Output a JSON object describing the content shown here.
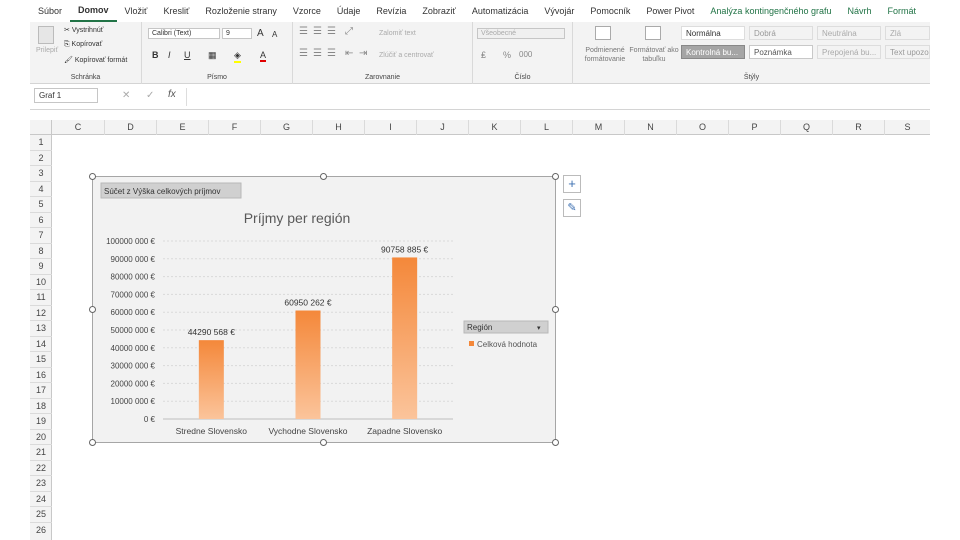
{
  "tabs": [
    "Súbor",
    "Domov",
    "Vložiť",
    "Kresliť",
    "Rozloženie strany",
    "Vzorce",
    "Údaje",
    "Revízia",
    "Zobraziť",
    "Automatizácia",
    "Vývojár",
    "Pomocník",
    "Power Pivot",
    "Analýza kontingenčného grafu",
    "Návrh",
    "Formát"
  ],
  "ribbon": {
    "clipboard": {
      "paste": "Prilepiť",
      "cut": "Vystrihnúť",
      "copy": "Kopírovať",
      "format": "Kopírovať formát",
      "label": "Schránka"
    },
    "font": {
      "name": "Calibri (Text)",
      "size": "9",
      "label": "Písmo",
      "grow": "A",
      "shrink": "A",
      "bold": "B",
      "italic": "I",
      "underline": "U",
      "color": "A"
    },
    "align": {
      "wrap": "Zalomiť text",
      "merge": "Zlúčiť a centrovať",
      "label": "Zarovnanie"
    },
    "number": {
      "format": "Všeobecné",
      "percent": "%",
      "comma": "000",
      "label": "Číslo"
    },
    "styles": {
      "cond": "Podmienené formátovanie",
      "table": "Formátovať ako tabuľku",
      "label": "Štýly",
      "items": [
        "Normálna",
        "Dobrá",
        "Neutrálna",
        "Zlá",
        "Kontrolná bu...",
        "Poznámka",
        "Prepojená bu...",
        "Text upozor..."
      ]
    }
  },
  "formula": {
    "name": "Graf 1",
    "cancel": "✕",
    "enter": "✓",
    "fx": "fx",
    "value": ""
  },
  "columns": [
    "C",
    "D",
    "E",
    "F",
    "G",
    "H",
    "I",
    "J",
    "K",
    "L",
    "M",
    "N",
    "O",
    "P",
    "Q",
    "R",
    "S"
  ],
  "rows": [
    "1",
    "2",
    "3",
    "4",
    "5",
    "6",
    "7",
    "8",
    "9",
    "10",
    "11",
    "12",
    "13",
    "14",
    "15",
    "16",
    "17",
    "18",
    "19",
    "20",
    "21",
    "22",
    "23",
    "24",
    "25",
    "26"
  ],
  "chart_data": {
    "type": "bar",
    "title": "Príjmy per región",
    "field_button": "Súčet z Výška celkových príjmov",
    "categories": [
      "Stredne Slovensko",
      "Vychodne Slovensko",
      "Zapadne Slovensko"
    ],
    "values": [
      44290568,
      60950262,
      90758885
    ],
    "data_labels": [
      "44290 568 €",
      "60950 262 €",
      "90758 885 €"
    ],
    "yticks": [
      "0 €",
      "10000 000 €",
      "20000 000 €",
      "30000 000 €",
      "40000 000 €",
      "50000 000 €",
      "60000 000 €",
      "70000 000 €",
      "80000 000 €",
      "90000 000 €",
      "100000 000 €"
    ],
    "ylim": [
      0,
      100000000
    ],
    "grid": true,
    "legend_title": "Región",
    "legend_entry": "Celková hodnota",
    "legend_position": "right",
    "color": "#f4883a"
  },
  "side_buttons": {
    "add": "+",
    "brush": "✎"
  }
}
